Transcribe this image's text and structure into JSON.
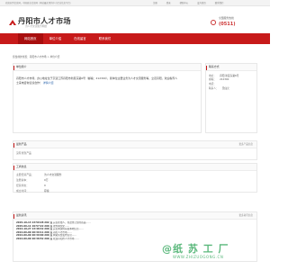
{
  "topbar": {
    "welcome": "欢迎来到信息网，中国商业信息网（网站最实用的中小企业信息平台）",
    "links": [
      "注册",
      "登录",
      "帮助中心",
      "设为首页",
      "联系我们"
    ]
  },
  "header": {
    "title": "丹阳市人才市场",
    "subtitle": "为人才交流服务网络",
    "phone_label": "全国服务热线",
    "phone_number": "(0511)"
  },
  "nav": {
    "items": [
      "网站首页",
      "单位介绍",
      "在线留言",
      "联系我们"
    ],
    "active_index": 0
  },
  "breadcrumb": "您当前的位置：丹阳市人才市场 > 单位介绍",
  "intro": {
    "title": "单位简介",
    "body": "丹阳市人才市场，办公地址位于京道江苏丹阳市新民东路6号（邮编：212300），我单位主要业务为人才交流服务等，立足丹阳，欢迎各界人士来电咨询洽谈合作！",
    "detail_link": "详情介绍"
  },
  "contact": {
    "title": "联系方式",
    "rows": [
      {
        "k": "地址：",
        "v": "丹阳 新民东路6号"
      },
      {
        "k": "邮编：",
        "v": "212300"
      },
      {
        "k": "电话：",
        "v": ""
      },
      {
        "k": "联系人：",
        "v": "吴仙元"
      }
    ]
  },
  "products": {
    "title": "最新产品",
    "more": "更多产品信息",
    "empty": "没有找到产品"
  },
  "business": {
    "title": "工商信息",
    "rows": [
      {
        "k": "主要经营产品：",
        "v": "为人才交流服务"
      },
      {
        "k": "注册资本：",
        "v": "0万"
      },
      {
        "k": "经营状态：",
        "v": "0"
      },
      {
        "k": "成立时间：",
        "v": "存续"
      }
    ]
  },
  "news": {
    "title": "最新资讯",
    "more": "更多资讯信息",
    "items": [
      {
        "t": "2015-10-13 13:59:28 202 点",
        "d": "完善在线人，在这里让您的商品……"
      },
      {
        "t": "2015-06-11 19:57:22 200 点",
        "d": "搜外网优化……"
      },
      {
        "t": "2014-10-27 13:48:42 200 点",
        "d": "完善本资料获取本地信息……"
      },
      {
        "t": "2014-06-09 20:39:11 200 点",
        "d": "丹阳人才市场……"
      },
      {
        "t": "2014-06-09 20:39:00 200 点",
        "d": "网站免费发布信息……"
      },
      {
        "t": "2014-06-09 20:38:52 200 点",
        "d": "欢迎丹阳市人才市场……"
      }
    ]
  },
  "watermark": {
    "main": "@纸 苏 工 厂",
    "sub": "WWW.ZHIZUOGONG.CN"
  },
  "colors": {
    "brand": "#c71a1a",
    "nav_active": "#a80e0e",
    "link": "#1c5aa6"
  }
}
